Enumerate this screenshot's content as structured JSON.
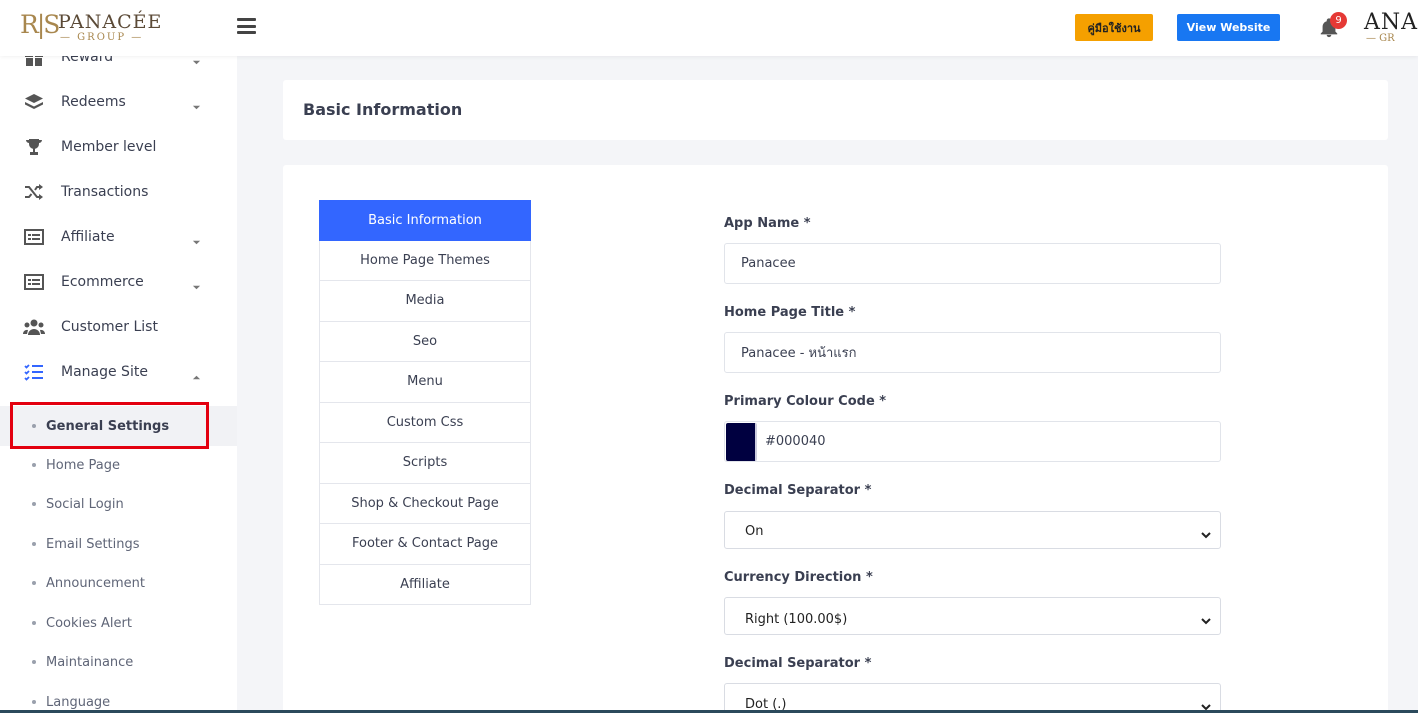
{
  "header": {
    "logo_mono": "R|S",
    "logo_brand": "PANACÉE",
    "logo_sub": "— GROUP —",
    "manual_button": "คู่มือใช้งาน",
    "view_website_button": "View Website",
    "notification_count": "9",
    "user_brand": "ANA",
    "user_sub": "— GR"
  },
  "sidebar": {
    "items": [
      {
        "label": "Reward",
        "icon": "gift-icon",
        "caret": "down"
      },
      {
        "label": "Redeems",
        "icon": "layers-icon",
        "caret": "down"
      },
      {
        "label": "Member level",
        "icon": "trophy-icon"
      },
      {
        "label": "Transactions",
        "icon": "shuffle-icon"
      },
      {
        "label": "Affiliate",
        "icon": "list-card-icon",
        "caret": "down"
      },
      {
        "label": "Ecommerce",
        "icon": "list-card-icon",
        "caret": "down"
      },
      {
        "label": "Customer List",
        "icon": "users-icon"
      },
      {
        "label": "Manage Site",
        "icon": "checklist-icon",
        "caret": "up"
      }
    ],
    "subitems": [
      {
        "label": "General Settings",
        "active": true
      },
      {
        "label": "Home Page"
      },
      {
        "label": "Social Login"
      },
      {
        "label": "Email Settings"
      },
      {
        "label": "Announcement"
      },
      {
        "label": "Cookies Alert"
      },
      {
        "label": "Maintainance"
      },
      {
        "label": "Language"
      }
    ]
  },
  "page": {
    "title": "Basic Information"
  },
  "tabs": [
    {
      "label": "Basic Information",
      "active": true
    },
    {
      "label": "Home Page Themes"
    },
    {
      "label": "Media"
    },
    {
      "label": "Seo"
    },
    {
      "label": "Menu"
    },
    {
      "label": "Custom Css"
    },
    {
      "label": "Scripts"
    },
    {
      "label": "Shop & Checkout Page"
    },
    {
      "label": "Footer & Contact Page"
    },
    {
      "label": "Affiliate"
    }
  ],
  "form": {
    "app_name_label": "App Name *",
    "app_name_value": "Panacee",
    "home_title_label": "Home Page Title *",
    "home_title_value": "Panacee - หน้าแรก",
    "primary_colour_label": "Primary Colour Code *",
    "primary_colour_value": "#000040",
    "decimal_sep_label": "Decimal Separator *",
    "decimal_sep_value": "On",
    "currency_dir_label": "Currency Direction *",
    "currency_dir_value": "Right (100.00$)",
    "decimal_sep2_label": "Decimal Separator *",
    "decimal_sep2_value": "Dot (.)"
  },
  "colors": {
    "accent": "#3366ff",
    "manual_button": "#f5a000",
    "view_button": "#1877f2",
    "highlight": "#e3000f",
    "swatch": "#000040"
  }
}
